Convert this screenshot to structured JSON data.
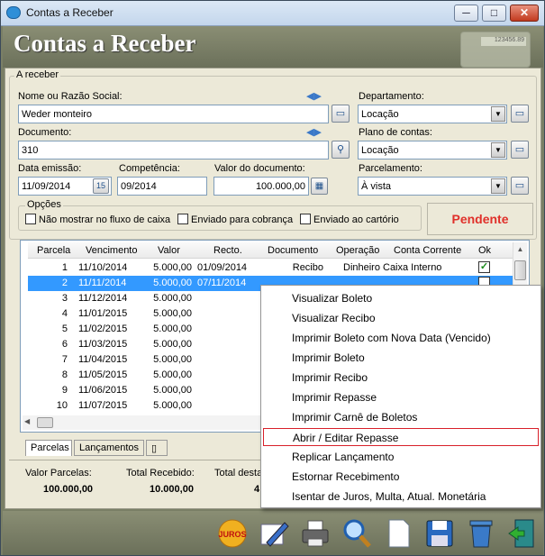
{
  "window": {
    "title": "Contas a Receber",
    "min_label": "─",
    "max_label": "□",
    "close_label": "✕"
  },
  "header": {
    "title": "Contas a Receber",
    "calc_display": "123456.89"
  },
  "form": {
    "group_title": "A receber",
    "nome_label": "Nome ou Razão Social:",
    "nome_value": "Weder monteiro",
    "documento_label": "Documento:",
    "documento_value": "310",
    "data_emissao_label": "Data emissão:",
    "data_emissao_value": "11/09/2014",
    "competencia_label": "Competência:",
    "competencia_value": "09/2014",
    "valor_label": "Valor do documento:",
    "valor_value": "100.000,00",
    "departamento_label": "Departamento:",
    "departamento_value": "Locação",
    "plano_label": "Plano de contas:",
    "plano_value": "Locação",
    "parcelamento_label": "Parcelamento:",
    "parcelamento_value": "À vista"
  },
  "opcoes": {
    "title": "Opções",
    "items": [
      {
        "label": "Não mostrar no fluxo de caixa"
      },
      {
        "label": "Enviado para cobrança"
      },
      {
        "label": "Enviado ao cartório"
      }
    ]
  },
  "status": {
    "label": "Pendente",
    "color": "#e0302a"
  },
  "grid": {
    "headers": [
      "Parcela",
      "Vencimento",
      "Valor",
      "Recto.",
      "Documento",
      "Operação",
      "Conta Corrente",
      "Ok"
    ],
    "rows": [
      {
        "parcela": "1",
        "venc": "11/10/2014",
        "valor": "5.000,00",
        "recto": "01/09/2014",
        "doc": "Recibo",
        "op": "Dinheiro",
        "conta": "Caixa Interno",
        "ok": true
      },
      {
        "parcela": "2",
        "venc": "11/11/2014",
        "valor": "5.000,00",
        "recto": "07/11/2014",
        "doc": "",
        "op": "",
        "conta": "",
        "ok": false
      },
      {
        "parcela": "3",
        "venc": "11/12/2014",
        "valor": "5.000,00",
        "recto": "",
        "doc": "",
        "op": "",
        "conta": "",
        "ok": false
      },
      {
        "parcela": "4",
        "venc": "11/01/2015",
        "valor": "5.000,00",
        "recto": "",
        "doc": "",
        "op": "",
        "conta": "",
        "ok": false
      },
      {
        "parcela": "5",
        "venc": "11/02/2015",
        "valor": "5.000,00",
        "recto": "",
        "doc": "",
        "op": "",
        "conta": "",
        "ok": false
      },
      {
        "parcela": "6",
        "venc": "11/03/2015",
        "valor": "5.000,00",
        "recto": "",
        "doc": "",
        "op": "",
        "conta": "",
        "ok": false
      },
      {
        "parcela": "7",
        "venc": "11/04/2015",
        "valor": "5.000,00",
        "recto": "",
        "doc": "",
        "op": "",
        "conta": "",
        "ok": false
      },
      {
        "parcela": "8",
        "venc": "11/05/2015",
        "valor": "5.000,00",
        "recto": "",
        "doc": "",
        "op": "",
        "conta": "",
        "ok": false
      },
      {
        "parcela": "9",
        "venc": "11/06/2015",
        "valor": "5.000,00",
        "recto": "",
        "doc": "",
        "op": "",
        "conta": "",
        "ok": false
      },
      {
        "parcela": "10",
        "venc": "11/07/2015",
        "valor": "5.000,00",
        "recto": "",
        "doc": "",
        "op": "",
        "conta": "",
        "ok": false
      }
    ],
    "selected_row": 1
  },
  "tabs": [
    {
      "label": "Parcelas"
    },
    {
      "label": "Lançamentos"
    }
  ],
  "summary": {
    "valor_parcelas_label": "Valor Parcelas:",
    "valor_parcelas_value": "100.000,00",
    "total_recebido_label": "Total Recebido:",
    "total_recebido_value": "10.000,00",
    "total_desta_label": "Total desta",
    "total_desta_value": "4"
  },
  "context_menu": [
    "Visualizar Boleto",
    "Visualizar Recibo",
    "Imprimir Boleto com Nova Data (Vencido)",
    "Imprimir Boleto",
    "Imprimir Recibo",
    "Imprimir Repasse",
    "Imprimir Carnê de Boletos",
    "Abrir / Editar Repasse",
    "Replicar Lançamento",
    "Estornar Recebimento",
    "Isentar de Juros, Multa, Atual. Monetária"
  ],
  "context_menu_highlighted": "Abrir / Editar Repasse",
  "toolbar": {
    "juros_label": "JUROS"
  },
  "icons": [
    "juros-icon",
    "edit-icon",
    "printer-icon",
    "search-icon",
    "new-document-icon",
    "save-icon",
    "delete-icon",
    "exit-icon"
  ]
}
